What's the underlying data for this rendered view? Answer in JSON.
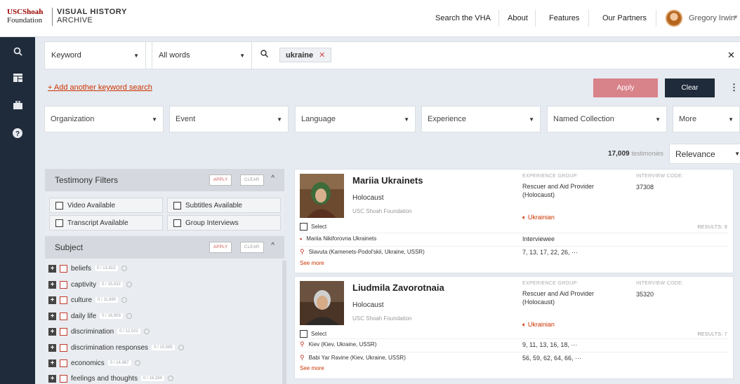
{
  "header": {
    "logo_usc_line1": "USCShoah",
    "logo_usc_line2": "Foundation",
    "logo_vha_line1": "VISUAL HISTORY",
    "logo_vha_line2": "ARCHIVE",
    "nav": [
      "Search the VHA",
      "About",
      "Features",
      "Our Partners"
    ],
    "user_name": "Gregory Irwin"
  },
  "search": {
    "field_select": "Keyword",
    "match_select": "All words",
    "chip": "ukraine",
    "add_keyword": "+ Add another keyword search",
    "apply_label": "Apply",
    "clear_label": "Clear"
  },
  "filters": [
    "Organization",
    "Event",
    "Language",
    "Experience",
    "Named Collection",
    "More"
  ],
  "results_count": "17,009",
  "results_count_label": "testimonies",
  "sort": "Relevance",
  "testimony_filters": {
    "title": "Testimony Filters",
    "apply": "APPLY",
    "clear": "CLEAR",
    "options": [
      "Video Available",
      "Subtitles Available",
      "Transcript Available",
      "Group Interviews"
    ]
  },
  "subject": {
    "title": "Subject",
    "apply": "APPLY",
    "clear": "CLEAR",
    "items": [
      {
        "label": "beliefs",
        "count": "0 / 13,815"
      },
      {
        "label": "captivity",
        "count": "0 / 15,032"
      },
      {
        "label": "culture",
        "count": "0 / 11,690"
      },
      {
        "label": "daily life",
        "count": "0 / 16,909"
      },
      {
        "label": "discrimination",
        "count": "0 / 12,022"
      },
      {
        "label": "discrimination responses",
        "count": "0 / 15,585"
      },
      {
        "label": "economics",
        "count": "0 / 14,987"
      },
      {
        "label": "feelings and thoughts",
        "count": "0 / 16,334"
      }
    ]
  },
  "results": [
    {
      "name": "Mariia Ukrainets",
      "subtitle": "Holocaust",
      "org": "USC Shoah Foundation",
      "exp_label": "EXPERIENCE GROUP:",
      "exp_value": "Rescuer and Aid Provider (Holocaust)",
      "ic_label": "INTERVIEW CODE:",
      "ic_value": "37308",
      "language": "Ukrainian",
      "select": "Select",
      "results_label": "RESULTS: 9",
      "rows": [
        {
          "left": "Mariia Nikiforovna Ukrainets",
          "right": "Interviewee"
        },
        {
          "left": "Slavuta (Kamenets-Podol'skii, Ukraine, USSR)",
          "right": "7, 13, 17, 22, 26, ···"
        }
      ],
      "see_more": "See more"
    },
    {
      "name": "Liudmila Zavorotnaia",
      "subtitle": "Holocaust",
      "org": "USC Shoah Foundation",
      "exp_label": "EXPERIENCE GROUP:",
      "exp_value": "Rescuer and Aid Provider (Holocaust)",
      "ic_label": "INTERVIEW CODE:",
      "ic_value": "35320",
      "language": "Ukrainian",
      "select": "Select",
      "results_label": "RESULTS: 7",
      "rows": [
        {
          "left": "Kiev (Kiev, Ukraine, USSR)",
          "right": "9, 11, 13, 16, 18, ···"
        },
        {
          "left": "Babi Yar Ravine (Kiev, Ukraine, USSR)",
          "right": "56, 59, 62, 64, 66, ···"
        }
      ],
      "see_more": "See more"
    }
  ],
  "icons": {
    "sidebar": [
      "search-icon",
      "dashboard-icon",
      "briefcase-icon",
      "help-icon"
    ],
    "accent": "#cc3300",
    "dark": "#1f2a3a"
  }
}
